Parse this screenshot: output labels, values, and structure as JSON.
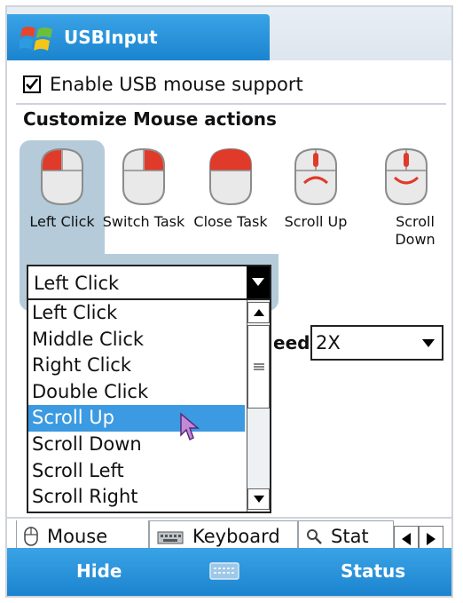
{
  "window": {
    "title": "USBInput"
  },
  "enable": {
    "label": "Enable USB mouse support",
    "checked": true
  },
  "section": {
    "title": "Customize Mouse actions"
  },
  "actions": [
    {
      "label": "Left Click",
      "icon": "mouse-left-click-icon",
      "selected": true
    },
    {
      "label": "Switch Task",
      "icon": "mouse-right-click-icon"
    },
    {
      "label": "Close Task",
      "icon": "mouse-middle-click-icon"
    },
    {
      "label": "Scroll Up",
      "icon": "mouse-scroll-up-icon"
    },
    {
      "label": "Scroll Down",
      "icon": "mouse-scroll-down-icon"
    }
  ],
  "dropdown": {
    "value": "Left Click",
    "options": [
      "Left Click",
      "Middle Click",
      "Right Click",
      "Double Click",
      "Scroll Up",
      "Scroll Down",
      "Scroll Left",
      "Scroll Right"
    ],
    "highlighted": "Scroll Up"
  },
  "speed": {
    "label_visible": "eed",
    "value": "2X"
  },
  "tabs": [
    {
      "label": "Mouse",
      "icon": "mouse-icon",
      "active": true
    },
    {
      "label": "Keyboard",
      "icon": "keyboard-icon"
    },
    {
      "label": "Stat",
      "icon": "magnifier-icon"
    }
  ],
  "softkeys": {
    "left": "Hide",
    "right": "Status",
    "center_icon": "keyboard-icon"
  },
  "colors": {
    "accent": "#1b84cf",
    "highlight": "#3b9ae1",
    "selection_bg": "#b5cbd9",
    "mouse_red": "#e03a2a"
  }
}
